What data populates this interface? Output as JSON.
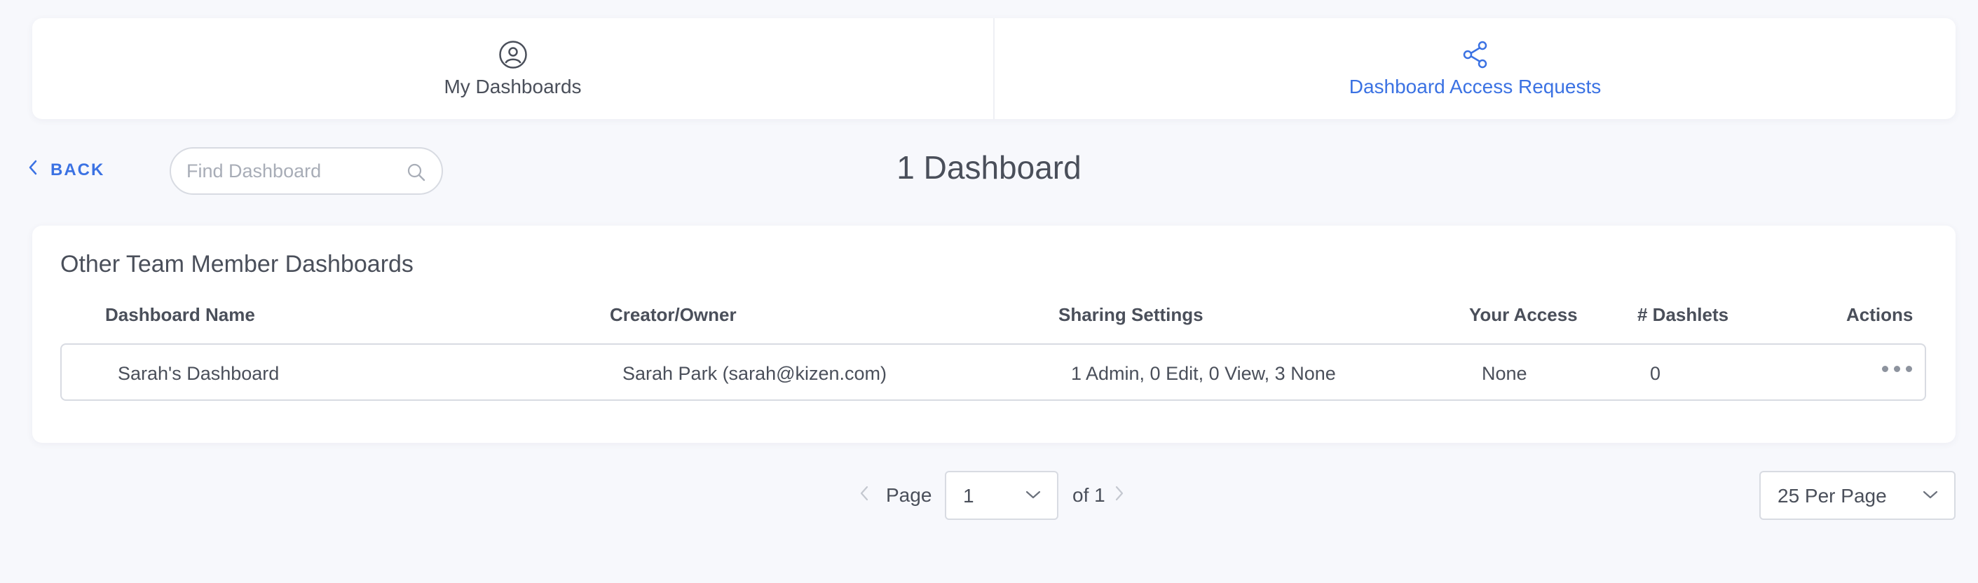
{
  "tabs": [
    {
      "label": "My Dashboards",
      "icon": "user-circle-icon",
      "active": false
    },
    {
      "label": "Dashboard Access Requests",
      "icon": "share-icon",
      "active": true
    }
  ],
  "toolbar": {
    "back_label": "BACK",
    "search_placeholder": "Find Dashboard",
    "count_label": "1 Dashboard"
  },
  "section": {
    "title": "Other Team Member Dashboards",
    "columns": [
      "Dashboard Name",
      "Creator/Owner",
      "Sharing Settings",
      "Your Access",
      "# Dashlets",
      "Actions"
    ],
    "rows": [
      {
        "name": "Sarah's Dashboard",
        "owner": "Sarah Park (sarah@kizen.com)",
        "sharing": "1 Admin, 0 Edit, 0 View, 3 None",
        "access": "None",
        "dashlets": "0"
      }
    ]
  },
  "pagination": {
    "page_label": "Page",
    "current_page": "1",
    "of_label": "of 1",
    "per_page": "25 Per Page"
  },
  "colors": {
    "accent": "#3b72e3",
    "background": "#f7f8fc",
    "text": "#4a4f5a",
    "border": "#d8dbe2"
  }
}
